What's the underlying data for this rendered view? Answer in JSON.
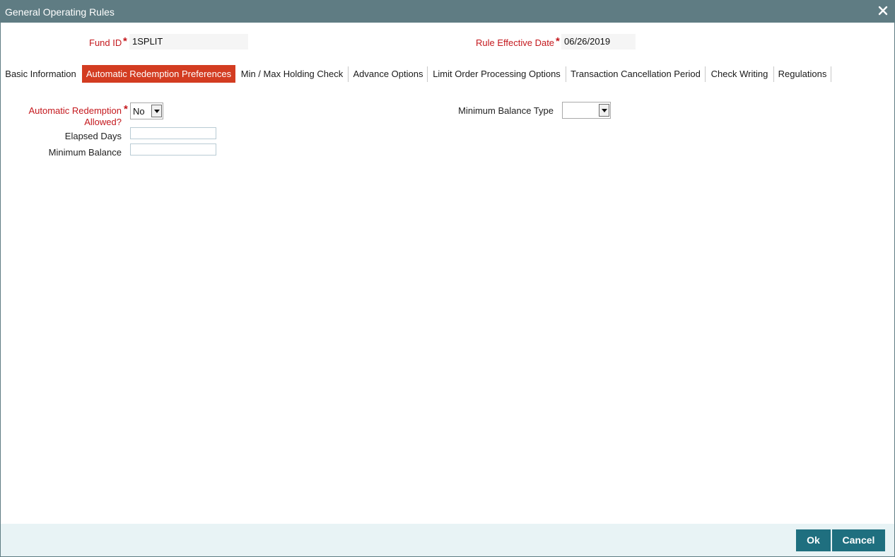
{
  "window": {
    "title": "General Operating Rules"
  },
  "header": {
    "fund_id_label": "Fund ID",
    "fund_id_value": "1SPLIT",
    "rule_date_label": "Rule Effective Date",
    "rule_date_value": "06/26/2019"
  },
  "tabs": [
    {
      "label": "Basic Information",
      "active": false
    },
    {
      "label": "Automatic Redemption Preferences",
      "active": true
    },
    {
      "label": "Min / Max Holding Check",
      "active": false
    },
    {
      "label": "Advance Options",
      "active": false
    },
    {
      "label": "Limit Order Processing Options",
      "active": false
    },
    {
      "label": "Transaction Cancellation Period",
      "active": false
    },
    {
      "label": "Check Writing",
      "active": false
    },
    {
      "label": "Regulations",
      "active": false
    }
  ],
  "form": {
    "auto_redemption_label_line1": "Automatic Redemption",
    "auto_redemption_label_line2": "Allowed?",
    "auto_redemption_value": "No",
    "elapsed_days_label": "Elapsed Days",
    "elapsed_days_value": "",
    "minimum_balance_label": "Minimum Balance",
    "minimum_balance_value": "",
    "minimum_balance_type_label": "Minimum Balance Type",
    "minimum_balance_type_value": ""
  },
  "footer": {
    "ok_label": "Ok",
    "cancel_label": "Cancel"
  },
  "colors": {
    "titlebar": "#5f7c83",
    "active_tab": "#d33c21",
    "required": "#c4181d",
    "button": "#1f6f7f",
    "footer": "#e8f3f5"
  },
  "icons": {
    "close": "close-icon",
    "dropdown": "chevron-down-icon"
  }
}
